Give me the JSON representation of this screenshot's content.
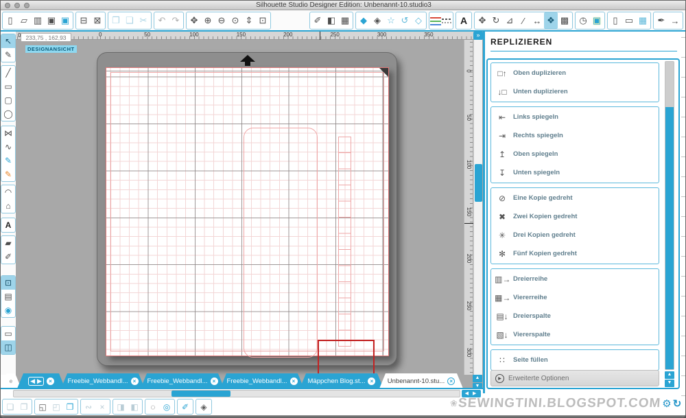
{
  "window": {
    "title": "Silhouette Studio Designer Edition: Unbenannt-10.studio3"
  },
  "toolbar_top": {
    "file_group": [
      {
        "name": "new-document-button",
        "glyph": "▯"
      },
      {
        "name": "open-button",
        "glyph": "▱"
      },
      {
        "name": "open-recent-button",
        "glyph": "▥"
      },
      {
        "name": "save-button",
        "glyph": "▣"
      },
      {
        "name": "save-to-library-button",
        "glyph": "▣",
        "cls": "blue"
      }
    ],
    "print_group": [
      {
        "name": "print-button",
        "glyph": "⊟"
      },
      {
        "name": "cutter-button",
        "glyph": "⊠"
      }
    ],
    "clipboard_group": [
      {
        "name": "copy-button",
        "glyph": "❐",
        "cls": "dim"
      },
      {
        "name": "paste-button",
        "glyph": "❏",
        "cls": "dim"
      },
      {
        "name": "cut-button",
        "glyph": "✂",
        "cls": "dim"
      }
    ],
    "history_group": [
      {
        "name": "undo-button",
        "glyph": "↶",
        "cls": "gray"
      },
      {
        "name": "redo-button",
        "glyph": "↷",
        "cls": "gray"
      }
    ],
    "view_group": [
      {
        "name": "pan-tool-button",
        "glyph": "✥"
      },
      {
        "name": "zoom-in-button",
        "glyph": "⊕"
      },
      {
        "name": "zoom-out-button",
        "glyph": "⊖"
      },
      {
        "name": "zoom-selection-button",
        "glyph": "⊙"
      },
      {
        "name": "drag-zoom-button",
        "glyph": "⇕"
      },
      {
        "name": "fit-to-window-button",
        "glyph": "⊡"
      }
    ],
    "style_group": [
      {
        "name": "simulation-button",
        "glyph": "✐"
      },
      {
        "name": "fill-settings-button",
        "glyph": "◧"
      },
      {
        "name": "raster-settings-button",
        "glyph": "▦"
      }
    ],
    "shape_style_group": [
      {
        "name": "fill-color-button",
        "glyph": "◆",
        "cls": "blue"
      },
      {
        "name": "shadow-button",
        "glyph": "◈"
      },
      {
        "name": "star-options-button",
        "glyph": "☆",
        "cls": "blue2"
      },
      {
        "name": "rotate-options-button",
        "glyph": "↺",
        "cls": "blue2"
      },
      {
        "name": "edit-shape-button",
        "glyph": "◇",
        "cls": "blue2"
      }
    ],
    "line_group": [
      {
        "name": "line-color-button",
        "glyph": "",
        "cls": "tricolor"
      },
      {
        "name": "line-style-button",
        "glyph": "",
        "cls": "dashes"
      }
    ],
    "text_group": [
      {
        "name": "text-style-button",
        "glyph": "A",
        "cls": "letter"
      }
    ],
    "transform_group": [
      {
        "name": "move-button",
        "glyph": "✥"
      },
      {
        "name": "rotate-button",
        "glyph": "↻"
      },
      {
        "name": "scale-button",
        "glyph": "⊿"
      },
      {
        "name": "shear-button",
        "glyph": "∕"
      },
      {
        "name": "align-button",
        "glyph": "↔"
      },
      {
        "name": "replicate-button",
        "glyph": "❖",
        "cls": "active"
      },
      {
        "name": "nest-button",
        "glyph": "▩"
      }
    ],
    "modify_group": [
      {
        "name": "stamp-button",
        "glyph": "◷"
      },
      {
        "name": "modify-button",
        "glyph": "▣",
        "cls": "yellow"
      }
    ],
    "page_group": [
      {
        "name": "page-setup-button",
        "glyph": "▯"
      },
      {
        "name": "mat-setup-button",
        "glyph": "▭"
      },
      {
        "name": "grid-settings-button",
        "glyph": "▦",
        "cls": "blue2"
      }
    ],
    "send_group": [
      {
        "name": "blade-settings-button",
        "glyph": "✒"
      },
      {
        "name": "send-to-silhouette-button",
        "glyph": "→"
      }
    ]
  },
  "left_toolbar": {
    "select_group": [
      {
        "name": "select-tool",
        "glyph": "↖",
        "cls": "active"
      },
      {
        "name": "edit-points-tool",
        "glyph": "✎"
      }
    ],
    "draw_group": [
      {
        "name": "line-tool",
        "glyph": "╱"
      },
      {
        "name": "rectangle-tool",
        "glyph": "▭"
      },
      {
        "name": "rounded-rectangle-tool",
        "glyph": "▢"
      },
      {
        "name": "ellipse-tool",
        "glyph": "◯"
      }
    ],
    "curve_group": [
      {
        "name": "polygon-tool",
        "glyph": "⋈"
      },
      {
        "name": "curve-tool",
        "glyph": "∿"
      },
      {
        "name": "freehand-tool",
        "glyph": "✎",
        "cls": "blue"
      },
      {
        "name": "smooth-freehand-tool",
        "glyph": "✎",
        "cls": "orange"
      }
    ],
    "arc_group": [
      {
        "name": "arc-tool",
        "glyph": "◠"
      },
      {
        "name": "regular-polygon-tool",
        "glyph": "⌂"
      }
    ],
    "text_group": [
      {
        "name": "text-tool",
        "glyph": "A",
        "cls": "letter"
      }
    ],
    "erase_group": [
      {
        "name": "eraser-tool",
        "glyph": "▰"
      },
      {
        "name": "knife-tool",
        "glyph": "✐"
      }
    ],
    "view_group": [
      {
        "name": "design-view-button",
        "glyph": "⊡",
        "cls": "active"
      },
      {
        "name": "library-button",
        "glyph": "▤"
      },
      {
        "name": "store-button",
        "glyph": "◉",
        "cls": "blue"
      }
    ],
    "window_group": [
      {
        "name": "single-window-button",
        "glyph": "▭"
      },
      {
        "name": "split-window-button",
        "glyph": "◫",
        "cls": "active"
      }
    ]
  },
  "canvas": {
    "coordinates": "233,75 , 162,93",
    "view_label": "DESIGNANSICHT",
    "ruler_corner": "0",
    "h_ruler": [
      "0",
      "50",
      "100",
      "150",
      "200",
      "250",
      "300",
      "350"
    ],
    "v_ruler": [
      "0",
      "50",
      "100",
      "150",
      "200",
      "250",
      "300"
    ],
    "expand_button": "»",
    "scroll_up": "▲",
    "scroll_down": "▼",
    "scroll_left_right": "◀ ▶"
  },
  "panel": {
    "title": "REPLIZIEREN",
    "groups": [
      [
        {
          "name": "duplicate-above-item",
          "icon": "□↑",
          "label": "Oben duplizieren"
        },
        {
          "name": "duplicate-below-item",
          "icon": "↓□",
          "label": "Unten duplizieren"
        }
      ],
      [
        {
          "name": "mirror-left-item",
          "icon": "⇤",
          "label": "Links spiegeln"
        },
        {
          "name": "mirror-right-item",
          "icon": "⇥",
          "label": "Rechts spiegeln"
        },
        {
          "name": "mirror-above-item",
          "icon": "↥",
          "label": "Oben spiegeln"
        },
        {
          "name": "mirror-below-item",
          "icon": "↧",
          "label": "Unten spiegeln"
        }
      ],
      [
        {
          "name": "one-copy-rotated-item",
          "icon": "⊘",
          "label": "Eine Kopie gedreht"
        },
        {
          "name": "two-copies-rotated-item",
          "icon": "✖",
          "label": "Zwei Kopien gedreht"
        },
        {
          "name": "three-copies-rotated-item",
          "icon": "✳",
          "label": "Drei Kopien gedreht"
        },
        {
          "name": "five-copies-rotated-item",
          "icon": "✻",
          "label": "Fünf Kopien gedreht"
        }
      ],
      [
        {
          "name": "row-of-three-item",
          "icon": "▥→",
          "label": "Dreierreihe"
        },
        {
          "name": "row-of-four-item",
          "icon": "▦→",
          "label": "Viererreihe"
        },
        {
          "name": "column-of-three-item",
          "icon": "▤↓",
          "label": "Dreierspalte"
        },
        {
          "name": "column-of-four-item",
          "icon": "▧↓",
          "label": "Viererspalte"
        }
      ],
      [
        {
          "name": "fill-page-item",
          "icon": "∷",
          "label": "Seite füllen"
        }
      ]
    ],
    "advanced_label": "Erweiterte Optionen",
    "scroll_up": "▲",
    "scroll_down": "▼"
  },
  "tabs": {
    "partial_label": "e",
    "nav_left": "◀",
    "nav_right": "▶",
    "nav_close": "×",
    "items": [
      {
        "name": "tab-freebie-webband-1",
        "label": "Freebie_Webbandl...",
        "close": "×"
      },
      {
        "name": "tab-freebie-webband-2",
        "label": "Freebie_Webbandl...",
        "close": "×"
      },
      {
        "name": "tab-freebie-webband-3",
        "label": "Freebie_Webbandl...",
        "close": "×"
      },
      {
        "name": "tab-maeppchen-blog",
        "label": "Mäppchen Blog.st...",
        "close": "×"
      },
      {
        "name": "tab-unbenannt-10",
        "label": "Unbenannt-10.stu...",
        "close": "×",
        "cls": "active"
      }
    ]
  },
  "bottom_toolbar": {
    "group_group": [
      {
        "name": "group-button",
        "glyph": "❏",
        "cls": "gray"
      },
      {
        "name": "ungroup-button",
        "glyph": "❐",
        "cls": "gray"
      }
    ],
    "compound_group": [
      {
        "name": "make-compound-path-button",
        "glyph": "◱"
      },
      {
        "name": "release-compound-path-button",
        "glyph": "◰",
        "cls": "gray"
      },
      {
        "name": "duplicate-button",
        "glyph": "❐",
        "cls": "blue"
      }
    ],
    "weld_group": [
      {
        "name": "weld-button",
        "glyph": "∾",
        "cls": "gray"
      },
      {
        "name": "delete-button",
        "glyph": "×",
        "cls": "gray"
      }
    ],
    "order_group": [
      {
        "name": "bring-forward-button",
        "glyph": "◨",
        "cls": "gray"
      },
      {
        "name": "send-backward-button",
        "glyph": "◧",
        "cls": "gray"
      }
    ],
    "offset_group": [
      {
        "name": "offset-button",
        "glyph": "◌"
      },
      {
        "name": "concentric-button",
        "glyph": "◎",
        "cls": "blue"
      }
    ],
    "picker_group": [
      {
        "name": "fill-picker-button",
        "glyph": "✐",
        "cls": "blue"
      }
    ],
    "emboss_group": [
      {
        "name": "emboss-button",
        "glyph": "◈"
      }
    ]
  },
  "watermark": {
    "flower": "❀",
    "text": "SEWINGTINI.BLOGSPOT.COM",
    "gear": "⚙",
    "refresh": "↻"
  },
  "colors": {
    "accent_blue": "#2aa4d3",
    "selected_shape_red": "#c32222",
    "light_shape_red": "#efa6a6",
    "mat_gray": "#8e8e8e"
  }
}
